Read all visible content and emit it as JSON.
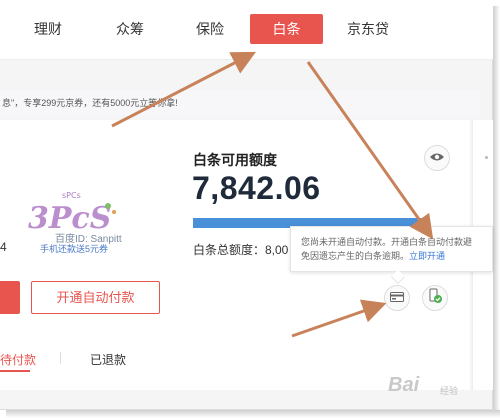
{
  "nav": {
    "items": [
      {
        "label": "理财"
      },
      {
        "label": "众筹"
      },
      {
        "label": "保险"
      },
      {
        "label": "白条",
        "active": true
      },
      {
        "label": "京东贷"
      }
    ],
    "active_color": "#e8544e"
  },
  "promo": {
    "text": "息\"，专享299元京券，还有5000元立等你拿!"
  },
  "credit": {
    "label": "白条可用额度",
    "value": "7,842.06",
    "usage_fraction": 1.0,
    "total_prefix": "白条总额度：8,00"
  },
  "watermark": {
    "brand": "3PcS",
    "sub_brand": "sPCs",
    "id_text": "百度ID: Sanpitt",
    "promo_link": "手机还款送5元券",
    "partial_number": "4"
  },
  "buttons": {
    "auto_pay": "开通自动付款"
  },
  "tabs": {
    "pending": "待付款",
    "refunded": "已退款"
  },
  "tooltip": {
    "line1": "您尚未开通自动付款。开通白条自动付款避",
    "line2": "免因遗忘产生的白条逾期。",
    "link": "立即开通"
  },
  "footer": {
    "brand": "Bai",
    "suffix": "经验"
  },
  "colors": {
    "accent": "#e8544e",
    "progress": "#4a90d9",
    "arrow": "#c8825a"
  }
}
